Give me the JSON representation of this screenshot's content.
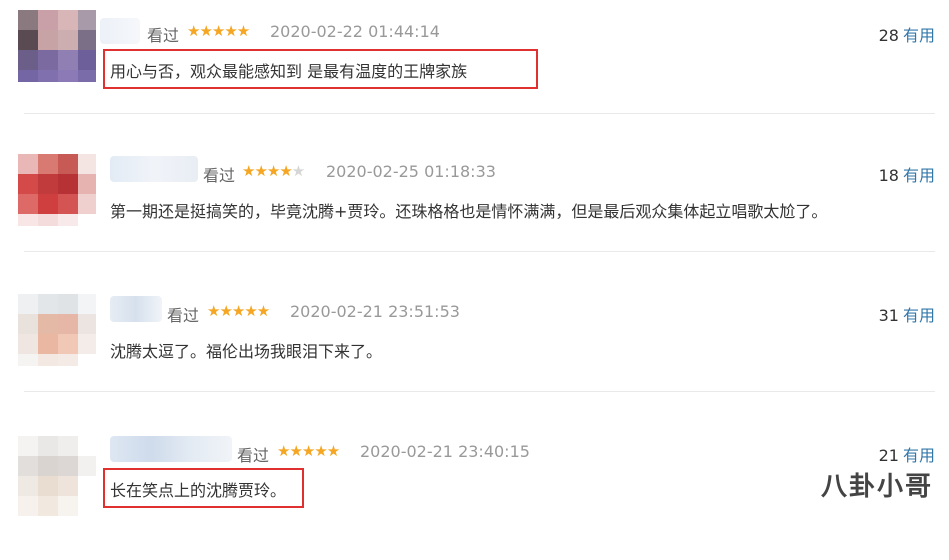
{
  "reviews": [
    {
      "watched_label": "看过",
      "stars": "★★★★★",
      "empty_stars": "",
      "time": "2020-02-22 01:44:14",
      "votes": "28",
      "useful_label": "有用",
      "comment": "用心与否，观众最能感知到 是最有温度的王牌家族",
      "highlighted": true
    },
    {
      "watched_label": "看过",
      "stars": "★★★★",
      "empty_stars": "★",
      "time": "2020-02-25 01:18:33",
      "votes": "18",
      "useful_label": "有用",
      "comment": "第一期还是挺搞笑的，毕竟沈腾+贾玲。还珠格格也是情怀满满，但是最后观众集体起立唱歌太尬了。",
      "highlighted": false
    },
    {
      "watched_label": "看过",
      "stars": "★★★★★",
      "empty_stars": "",
      "time": "2020-02-21 23:51:53",
      "votes": "31",
      "useful_label": "有用",
      "comment": "沈腾太逗了。福伦出场我眼泪下来了。",
      "highlighted": false
    },
    {
      "watched_label": "看过",
      "stars": "★★★★★",
      "empty_stars": "",
      "time": "2020-02-21 23:40:15",
      "votes": "21",
      "useful_label": "有用",
      "comment": "长在笑点上的沈腾贾玲。",
      "highlighted": true
    }
  ],
  "watermark": "八卦小哥",
  "colors": {
    "star": "#f5a623",
    "link": "#3377aa",
    "highlight_box": "#e03030"
  }
}
